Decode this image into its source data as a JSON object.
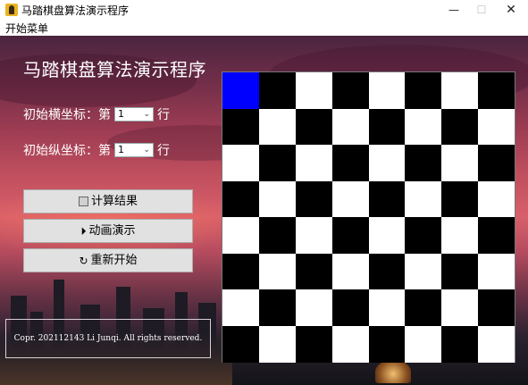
{
  "window": {
    "title": "马踏棋盘算法演示程序",
    "minimize_icon": "minimize-icon",
    "maximize_icon": "maximize-icon",
    "close_icon": "close-icon",
    "minimize_glyph": "—",
    "maximize_glyph": "☐",
    "close_glyph": "✕"
  },
  "menu": {
    "items": [
      "开始菜单"
    ]
  },
  "main": {
    "heading": "马踏棋盘算法演示程序",
    "x_coord": {
      "label": "初始横坐标：第",
      "value": "1",
      "suffix": "行"
    },
    "y_coord": {
      "label": "初始纵坐标：第",
      "value": "1",
      "suffix": "行"
    },
    "buttons": {
      "compute": "计算结果",
      "animate": "动画演示",
      "restart": "重新开始"
    },
    "copyright": "Copr. 202112143 Li Junqi. All rights reserved."
  },
  "board": {
    "rows": 8,
    "cols": 8,
    "highlight": {
      "row": 0,
      "col": 0
    },
    "colors": {
      "dark": "#000000",
      "light": "#ffffff",
      "highlight": "#0000ff"
    }
  }
}
